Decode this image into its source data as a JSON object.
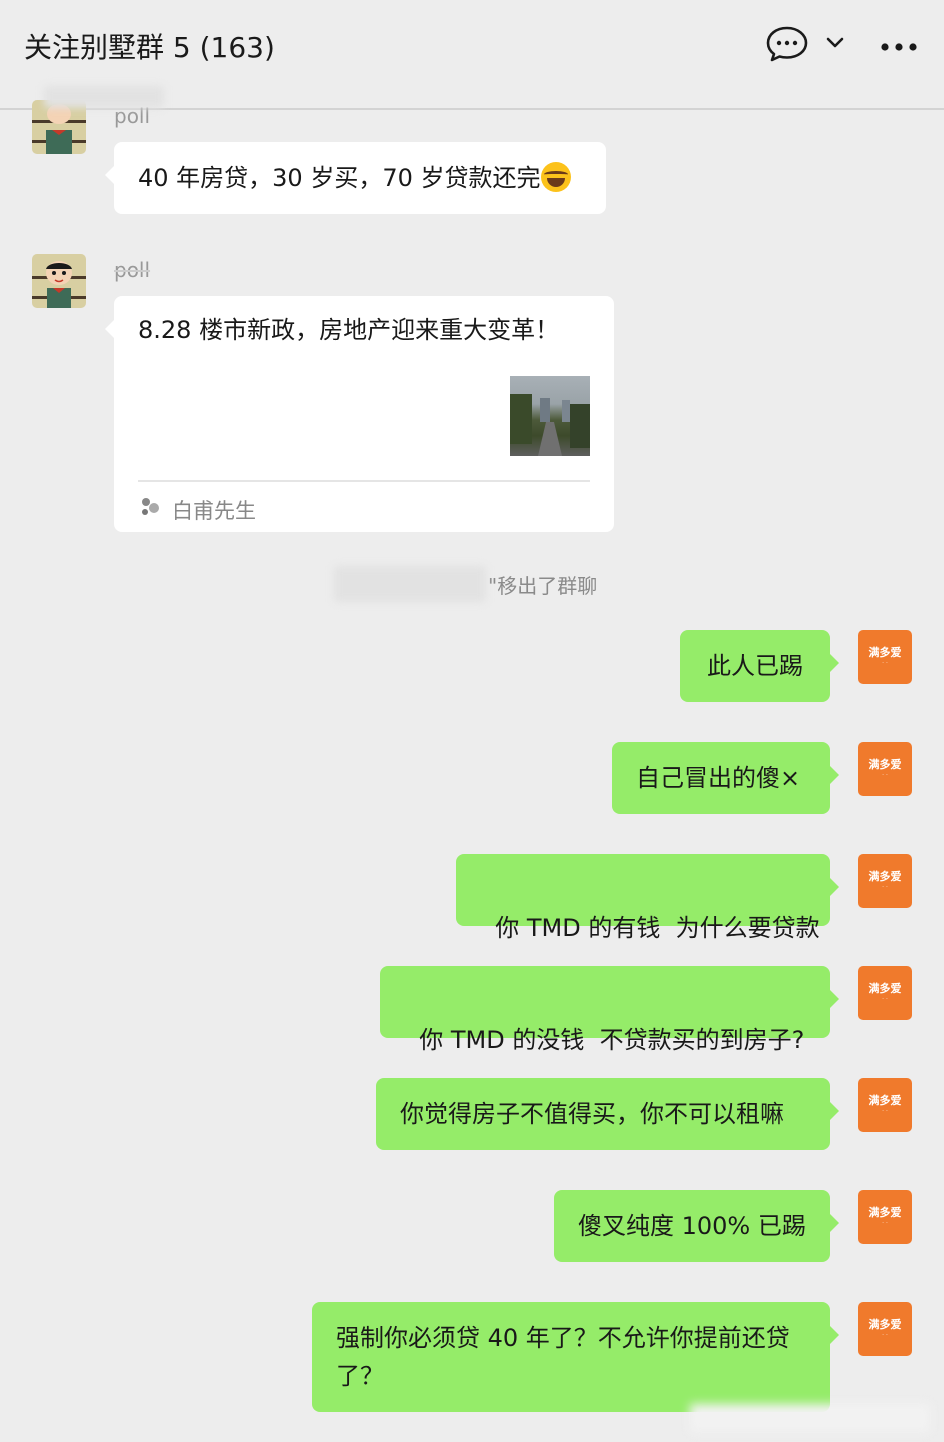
{
  "header": {
    "title": "关注别墅群 5 (163)"
  },
  "messages_in": [
    {
      "sender": "poll",
      "text": "40 年房贷，30 岁买，70 岁贷款还完",
      "emoji": "tears-of-joy-emoji"
    },
    {
      "sender": "poll",
      "card": {
        "title": "8.28 楼市新政，房地产迎来重大变革！",
        "source": "白甫先生"
      }
    }
  ],
  "system_notice": {
    "text": "\"移出了群聊"
  },
  "self_avatar": {
    "line1": "满多爱",
    "line2": "· ·"
  },
  "messages_out": [
    {
      "text": "此人已踢"
    },
    {
      "text": "自己冒出的傻×"
    },
    {
      "text": "你 TMD 的有钱  为什么要贷款"
    },
    {
      "text": "你 TMD 的没钱  不贷款买的到房子?"
    },
    {
      "text": "你觉得房子不值得买，你不可以租嘛"
    },
    {
      "text": "傻叉纯度 100% 已踢"
    },
    {
      "text": "强制你必须贷 40 年了？不允许你提前还贷了？"
    }
  ]
}
